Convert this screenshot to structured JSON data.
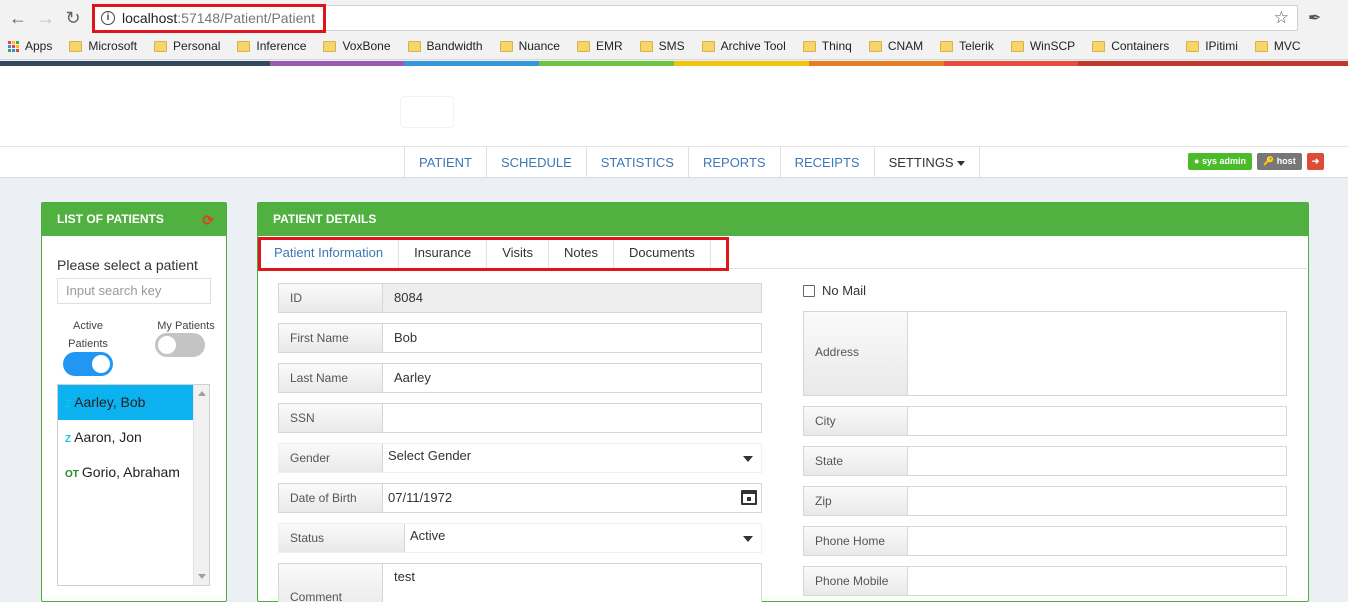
{
  "browser": {
    "url_host": "localhost",
    "url_rest": ":57148/Patient/Patient",
    "bookmarks": [
      "Apps",
      "Microsoft",
      "Personal",
      "Inference",
      "VoxBone",
      "Bandwidth",
      "Nuance",
      "EMR",
      "SMS",
      "Archive Tool",
      "Thinq",
      "CNAM",
      "Telerik",
      "WinSCP",
      "Containers",
      "IPitimi",
      "MVC"
    ]
  },
  "colors": {
    "accent_green": "#50b040",
    "highlight_red": "#e0141b",
    "selected_blue": "#0cb2f0",
    "link_blue": "#3c78b4",
    "colorbar": [
      "#34495e",
      "#34495e",
      "#9b59b6",
      "#3498db",
      "#6cc644",
      "#f1c40f",
      "#e67e22",
      "#e74c3c",
      "#c0392b",
      "#c0392b"
    ]
  },
  "nav": {
    "items": [
      "PATIENT",
      "SCHEDULE",
      "STATISTICS",
      "REPORTS",
      "RECEIPTS",
      "SETTINGS"
    ]
  },
  "user": {
    "name_btn": "sys admin",
    "host_btn": "host",
    "logout_icon": "sign-out-icon"
  },
  "patient_list": {
    "header": "LIST OF PATIENTS",
    "prompt": "Please select a patient",
    "search_placeholder": "Input search key",
    "toggle_active_label": "Active Patients",
    "toggle_active_on": true,
    "toggle_mine_label": "My Patients",
    "toggle_mine_on": false,
    "patients": [
      {
        "tag": "Z",
        "tag_color": "#13c7d6",
        "name": "Aarley, Bob",
        "selected": true
      },
      {
        "tag": "Z",
        "tag_color": "#13c7d6",
        "name": "Aaron, Jon",
        "selected": false
      },
      {
        "tag": "OT",
        "tag_color": "#1e8a2a",
        "name": "Gorio, Abraham",
        "selected": false
      }
    ]
  },
  "details": {
    "header": "PATIENT DETAILS",
    "tabs": [
      "Patient Information",
      "Insurance",
      "Visits",
      "Notes",
      "Documents"
    ],
    "left_fields": [
      {
        "label": "ID",
        "value": "8084"
      },
      {
        "label": "First Name",
        "value": "Bob"
      },
      {
        "label": "Last Name",
        "value": "Aarley"
      },
      {
        "label": "SSN",
        "value": ""
      },
      {
        "label": "Gender",
        "value": "Select Gender"
      },
      {
        "label": "Date of Birth",
        "value": "07/11/1972"
      },
      {
        "label": "Status",
        "value": "Active"
      },
      {
        "label": "Comment",
        "value": "test"
      }
    ],
    "no_mail_label": "No Mail",
    "right_fields": [
      {
        "label": "Address",
        "value": ""
      },
      {
        "label": "City",
        "value": ""
      },
      {
        "label": "State",
        "value": ""
      },
      {
        "label": "Zip",
        "value": ""
      },
      {
        "label": "Phone Home",
        "value": ""
      },
      {
        "label": "Phone Mobile",
        "value": ""
      }
    ]
  }
}
